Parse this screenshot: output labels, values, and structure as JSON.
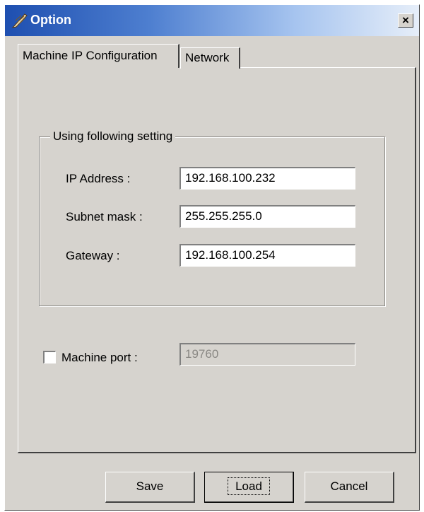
{
  "window": {
    "title": "Option",
    "close_label": "×"
  },
  "tabs": [
    {
      "label": "Machine IP Configuration",
      "active": true
    },
    {
      "label": "Network",
      "active": false
    }
  ],
  "group": {
    "title": "Using following setting",
    "ip_label": "IP Address :",
    "ip_value": "192.168.100.232",
    "subnet_label": "Subnet mask :",
    "subnet_value": "255.255.255.0",
    "gateway_label": "Gateway :",
    "gateway_value": "192.168.100.254"
  },
  "port": {
    "label": "Machine port :",
    "value": "19760",
    "checked": false,
    "enabled": false
  },
  "buttons": {
    "save": "Save",
    "load": "Load",
    "cancel": "Cancel"
  },
  "icons": {
    "title_icon": "app-feather-icon"
  }
}
